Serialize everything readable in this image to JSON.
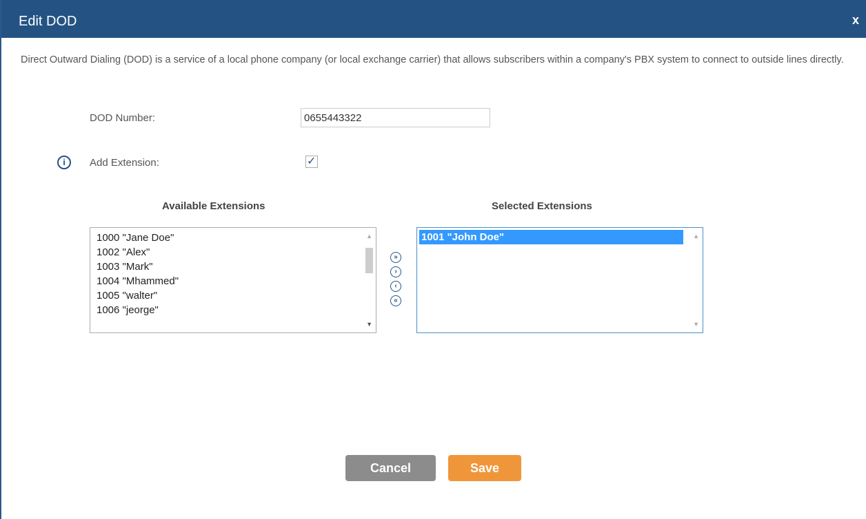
{
  "dialog": {
    "title": "Edit DOD",
    "close_label": "x",
    "description": "Direct Outward Dialing (DOD) is a service of a local phone company (or local exchange carrier) that allows subscribers within a company's PBX system to connect to outside lines directly."
  },
  "form": {
    "dod_number_label": "DOD Number:",
    "dod_number_value": "0655443322",
    "add_extension_label": "Add Extension:",
    "add_extension_checked": true,
    "info_icon": "info-circle-icon"
  },
  "available": {
    "header": "Available Extensions",
    "items": [
      "1000 \"Jane Doe\"",
      "1002 \"Alex\"",
      "1003 \"Mark\"",
      "1004 \"Mhammed\"",
      "1005 \"walter\"",
      "1006 \"jeorge\""
    ]
  },
  "selected": {
    "header": "Selected Extensions",
    "items": [
      "1001 \"John Doe\""
    ]
  },
  "movers": {
    "add_all": "⊳|",
    "add": ">",
    "remove": "<",
    "remove_all": "|⊲"
  },
  "buttons": {
    "cancel": "Cancel",
    "save": "Save"
  },
  "colors": {
    "titlebar": "#245383",
    "selection": "#3399ff",
    "save": "#f0963a",
    "cancel": "#8c8c8c"
  }
}
